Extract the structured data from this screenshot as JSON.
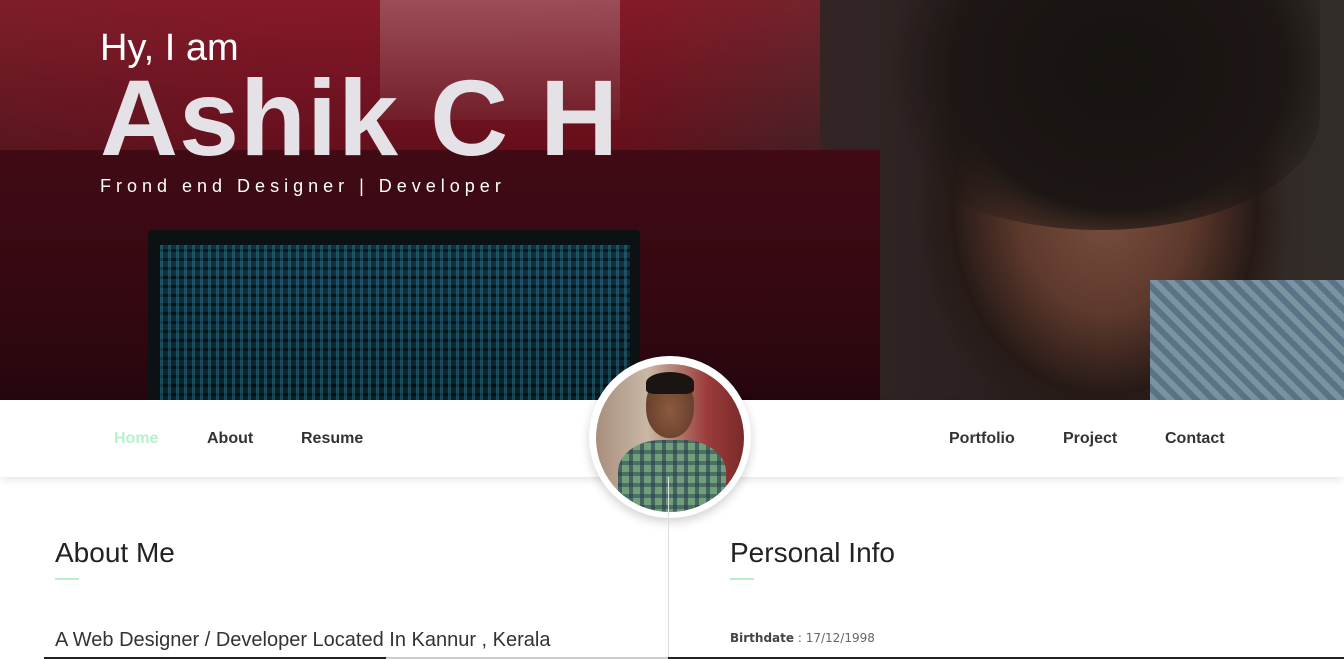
{
  "hero": {
    "greeting": "Hy, I am",
    "name": "Ashik C H",
    "role": "Frond end Designer | Developer"
  },
  "nav": {
    "left": [
      {
        "label": "Home",
        "active": true
      },
      {
        "label": "About",
        "active": false
      },
      {
        "label": "Resume",
        "active": false
      }
    ],
    "right": [
      {
        "label": "Portfolio",
        "active": false
      },
      {
        "label": "Project",
        "active": false
      },
      {
        "label": "Contact",
        "active": false
      }
    ],
    "active_color": "#b8f0cc"
  },
  "about": {
    "title": "About Me",
    "text": "A Web Designer / Developer Located In Kannur , Kerala"
  },
  "personal_info": {
    "title": "Personal Info",
    "birthdate_label": "Birthdate",
    "birthdate_value": "17/12/1998"
  },
  "colors": {
    "accent": "#b8f0cc",
    "text_dark": "#222222"
  }
}
